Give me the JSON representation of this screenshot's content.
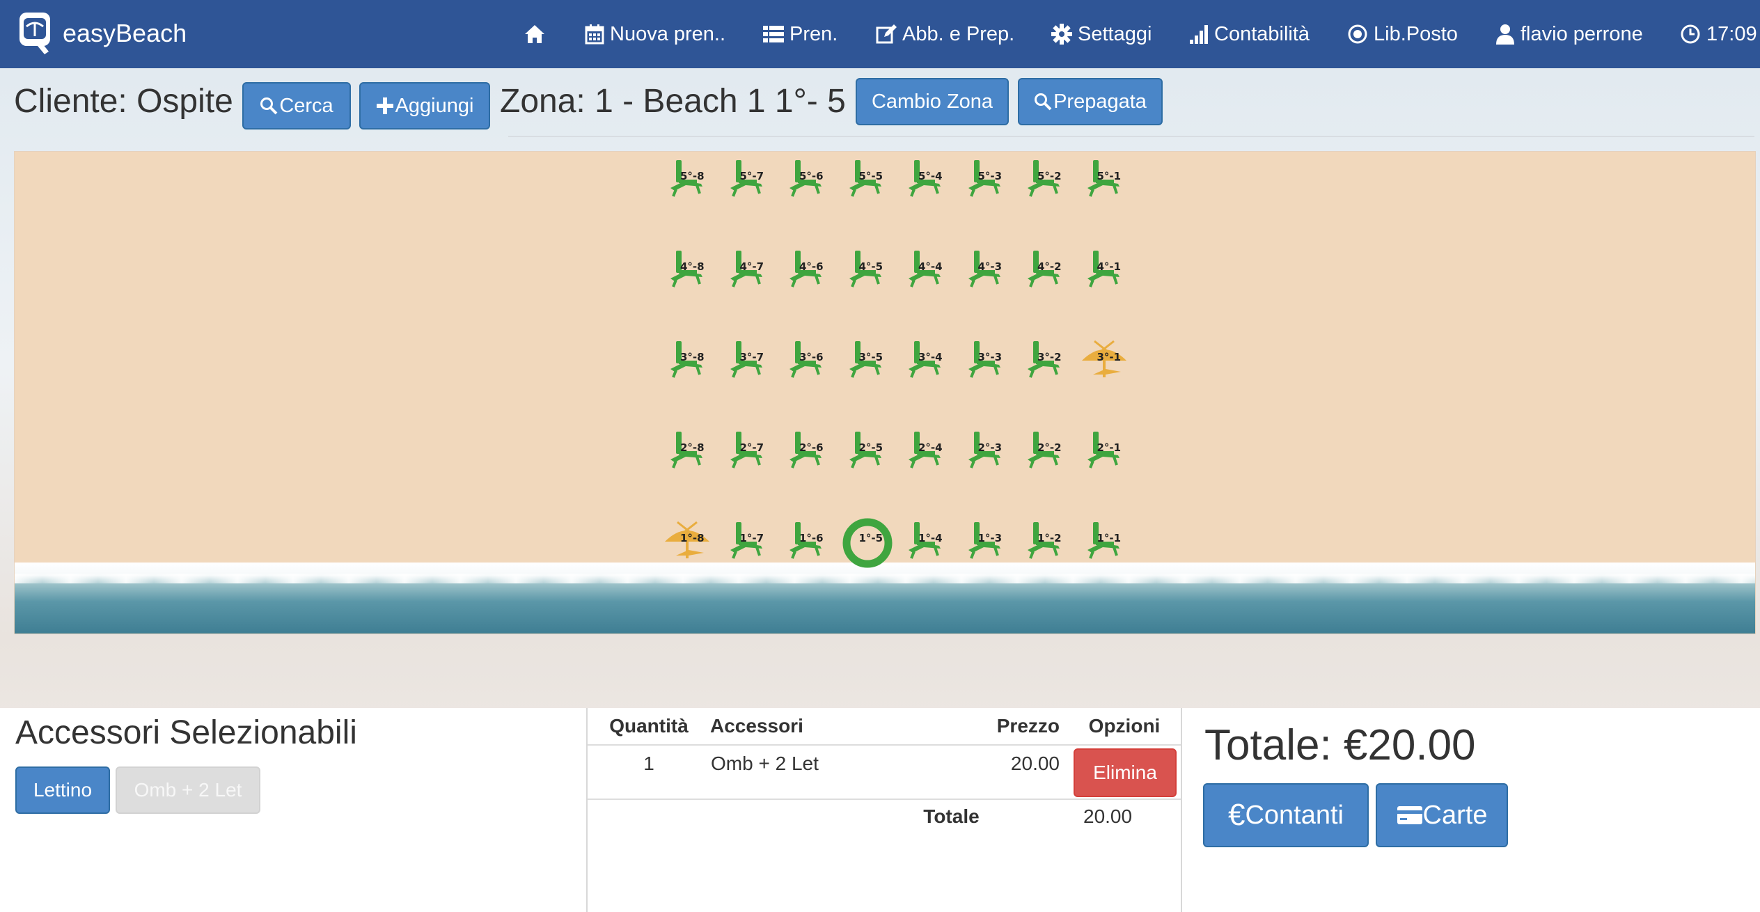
{
  "navbar": {
    "brand": "easyBeach",
    "items": [
      {
        "label": "",
        "icon": "home-icon"
      },
      {
        "label": "Nuova pren..",
        "icon": "calendar-icon"
      },
      {
        "label": "Pren.",
        "icon": "list-icon"
      },
      {
        "label": "Abb. e Prep.",
        "icon": "edit-icon"
      },
      {
        "label": "Settaggi",
        "icon": "gear-icon"
      },
      {
        "label": "Contabilità",
        "icon": "bar-chart-icon"
      },
      {
        "label": "Lib.Posto",
        "icon": "record-icon"
      },
      {
        "label": "flavio perrone",
        "icon": "user-icon"
      },
      {
        "label": "17:09",
        "icon": "clock-icon"
      }
    ]
  },
  "client": {
    "label": "Cliente: Ospite",
    "search_button": "Cerca",
    "add_button": "Aggiungi",
    "zone_label": "Zona: 1 - Beach 1 1°- 5",
    "change_zone_button": "Cambio Zona",
    "prepaid_button": "Prepagata"
  },
  "colors": {
    "navbar": "#2f5596",
    "primary": "#4a86c8",
    "danger": "#d9534f",
    "free_spot": "#3fa53f",
    "occupied_spot": "#e9ad3e",
    "sand": "#f1d8bc"
  },
  "beach": {
    "rows": [
      {
        "row": 5,
        "spots": [
          {
            "label": "5°-8",
            "status": "free"
          },
          {
            "label": "5°-7",
            "status": "free"
          },
          {
            "label": "5°-6",
            "status": "free"
          },
          {
            "label": "5°-5",
            "status": "free"
          },
          {
            "label": "5°-4",
            "status": "free"
          },
          {
            "label": "5°-3",
            "status": "free"
          },
          {
            "label": "5°-2",
            "status": "free"
          },
          {
            "label": "5°-1",
            "status": "free"
          }
        ]
      },
      {
        "row": 4,
        "spots": [
          {
            "label": "4°-8",
            "status": "free"
          },
          {
            "label": "4°-7",
            "status": "free"
          },
          {
            "label": "4°-6",
            "status": "free"
          },
          {
            "label": "4°-5",
            "status": "free"
          },
          {
            "label": "4°-4",
            "status": "free"
          },
          {
            "label": "4°-3",
            "status": "free"
          },
          {
            "label": "4°-2",
            "status": "free"
          },
          {
            "label": "4°-1",
            "status": "free"
          }
        ]
      },
      {
        "row": 3,
        "spots": [
          {
            "label": "3°-8",
            "status": "free"
          },
          {
            "label": "3°-7",
            "status": "free"
          },
          {
            "label": "3°-6",
            "status": "free"
          },
          {
            "label": "3°-5",
            "status": "free"
          },
          {
            "label": "3°-4",
            "status": "free"
          },
          {
            "label": "3°-3",
            "status": "free"
          },
          {
            "label": "3°-2",
            "status": "free"
          },
          {
            "label": "3°-1",
            "status": "occupied"
          }
        ]
      },
      {
        "row": 2,
        "spots": [
          {
            "label": "2°-8",
            "status": "free"
          },
          {
            "label": "2°-7",
            "status": "free"
          },
          {
            "label": "2°-6",
            "status": "free"
          },
          {
            "label": "2°-5",
            "status": "free"
          },
          {
            "label": "2°-4",
            "status": "free"
          },
          {
            "label": "2°-3",
            "status": "free"
          },
          {
            "label": "2°-2",
            "status": "free"
          },
          {
            "label": "2°-1",
            "status": "free"
          }
        ]
      },
      {
        "row": 1,
        "spots": [
          {
            "label": "1°-8",
            "status": "occupied"
          },
          {
            "label": "1°-7",
            "status": "free"
          },
          {
            "label": "1°-6",
            "status": "free"
          },
          {
            "label": "1°-5",
            "status": "selected"
          },
          {
            "label": "1°-4",
            "status": "free"
          },
          {
            "label": "1°-3",
            "status": "free"
          },
          {
            "label": "1°-2",
            "status": "free"
          },
          {
            "label": "1°-1",
            "status": "free"
          }
        ]
      }
    ]
  },
  "accessories": {
    "title": "Accessori Selezionabili",
    "buttons": [
      {
        "label": "Lettino",
        "enabled": true
      },
      {
        "label": "Omb + 2 Let",
        "enabled": false
      }
    ]
  },
  "cart": {
    "headers": [
      "Quantità",
      "Accessori",
      "Prezzo",
      "Opzioni"
    ],
    "rows": [
      {
        "quantity": "1",
        "accessory": "Omb + 2 Let",
        "price": "20.00",
        "action": "Elimina"
      }
    ],
    "total_label": "Totale",
    "total_value": "20.00"
  },
  "summary": {
    "total": "Totale: €20.00",
    "cash_button": "Contanti",
    "card_button": "Carte"
  }
}
